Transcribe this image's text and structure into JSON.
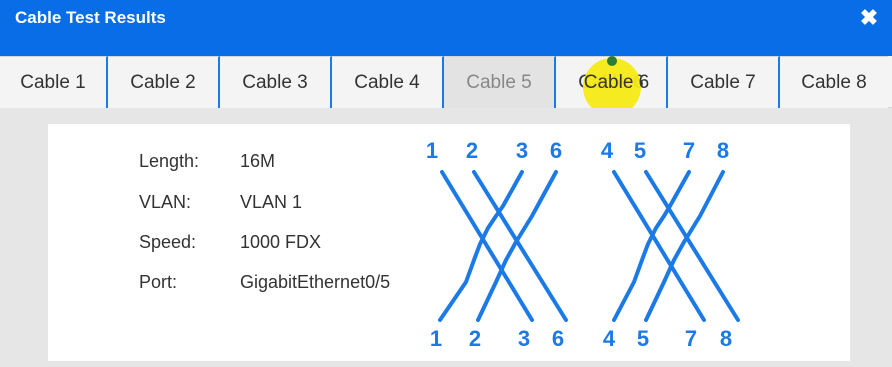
{
  "window": {
    "title": "Cable Test Results",
    "close_icon": "close-icon"
  },
  "tabs": [
    {
      "label": "Cable 1",
      "active": false
    },
    {
      "label": "Cable 2",
      "active": false
    },
    {
      "label": "Cable 3",
      "active": false
    },
    {
      "label": "Cable 4",
      "active": false
    },
    {
      "label": "Cable 5",
      "active": true
    },
    {
      "label": "Cable 6",
      "active": false
    },
    {
      "label": "Cable 7",
      "active": false
    },
    {
      "label": "Cable 8",
      "active": false
    }
  ],
  "details": {
    "length_label": "Length:",
    "length_value": "16M",
    "vlan_label": "VLAN:",
    "vlan_value": "VLAN 1",
    "speed_label": "Speed:",
    "speed_value": "1000 FDX",
    "port_label": "Port:",
    "port_value": "GigabitEthernet0/5"
  },
  "pinout": {
    "top_pins": [
      "1",
      "2",
      "3",
      "6",
      "4",
      "5",
      "7",
      "8"
    ],
    "bottom_pins": [
      "1",
      "2",
      "3",
      "6",
      "4",
      "5",
      "7",
      "8"
    ]
  },
  "colors": {
    "titlebar": "#0a6de8",
    "accent": "#1c7ae6",
    "highlight": "#f4ea14"
  }
}
